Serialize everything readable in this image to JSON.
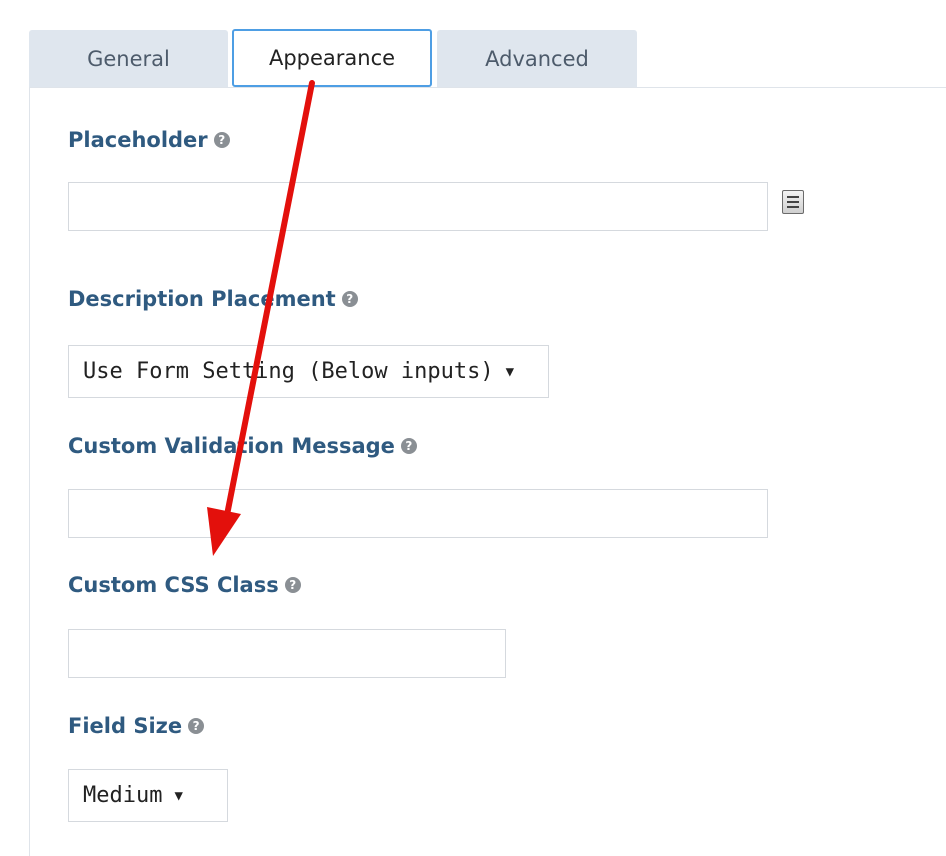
{
  "tabs": [
    {
      "label": "General"
    },
    {
      "label": "Appearance"
    },
    {
      "label": "Advanced"
    }
  ],
  "fields": {
    "placeholder": {
      "label": "Placeholder",
      "value": ""
    },
    "description_placement": {
      "label": "Description Placement",
      "selected": "Use Form Setting (Below inputs)"
    },
    "custom_validation_message": {
      "label": "Custom Validation Message",
      "value": ""
    },
    "custom_css_class": {
      "label": "Custom CSS Class",
      "value": ""
    },
    "field_size": {
      "label": "Field Size",
      "selected": "Medium"
    }
  },
  "icons": {
    "help": "help-circle-icon",
    "merge_tag": "merge-tag-icon",
    "dropdown": "caret-down-icon"
  },
  "colors": {
    "label": "#2f5a80",
    "active_tab_border": "#4e9ee4",
    "annotation_arrow": "#e3100c"
  }
}
